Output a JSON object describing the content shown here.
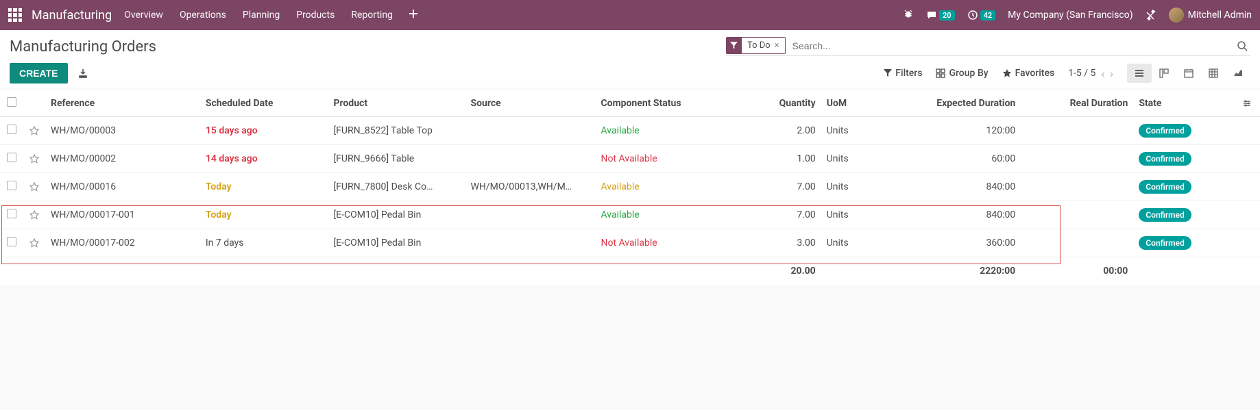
{
  "navbar": {
    "brand": "Manufacturing",
    "menu": [
      "Overview",
      "Operations",
      "Planning",
      "Products",
      "Reporting"
    ],
    "msg_badge": "20",
    "activity_badge": "42",
    "company": "My Company (San Francisco)",
    "user": "Mitchell Admin"
  },
  "header": {
    "title": "Manufacturing Orders",
    "create_label": "CREATE",
    "filter_facet": "To Do",
    "search_placeholder": "Search..."
  },
  "toolbar": {
    "filters_label": "Filters",
    "groupby_label": "Group By",
    "favorites_label": "Favorites",
    "pager_range": "1-5",
    "pager_total": "5"
  },
  "columns": {
    "reference": "Reference",
    "scheduled": "Scheduled Date",
    "product": "Product",
    "source": "Source",
    "component_status": "Component Status",
    "quantity": "Quantity",
    "uom": "UoM",
    "expected": "Expected Duration",
    "real": "Real Duration",
    "state": "State"
  },
  "rows": [
    {
      "ref": "WH/MO/00003",
      "date": "15 days ago",
      "date_cls": "overdue",
      "product": "[FURN_8522] Table Top",
      "source": "",
      "comp": "Available",
      "comp_cls": "status-available",
      "qty": "2.00",
      "uom": "Units",
      "expected": "120:00",
      "real": "",
      "state": "Confirmed"
    },
    {
      "ref": "WH/MO/00002",
      "date": "14 days ago",
      "date_cls": "overdue",
      "product": "[FURN_9666] Table",
      "source": "",
      "comp": "Not Available",
      "comp_cls": "status-notavail",
      "qty": "1.00",
      "uom": "Units",
      "expected": "60:00",
      "real": "",
      "state": "Confirmed"
    },
    {
      "ref": "WH/MO/00016",
      "date": "Today",
      "date_cls": "today",
      "product": "[FURN_7800] Desk Co…",
      "source": "WH/MO/00013,WH/M…",
      "comp": "Available",
      "comp_cls": "status-avail-warn",
      "qty": "7.00",
      "uom": "Units",
      "expected": "840:00",
      "real": "",
      "state": "Confirmed"
    },
    {
      "ref": "WH/MO/00017-001",
      "date": "Today",
      "date_cls": "today",
      "product": "[E-COM10] Pedal Bin",
      "source": "",
      "comp": "Available",
      "comp_cls": "status-available",
      "qty": "7.00",
      "uom": "Units",
      "expected": "840:00",
      "real": "",
      "state": "Confirmed"
    },
    {
      "ref": "WH/MO/00017-002",
      "date": "In 7 days",
      "date_cls": "future",
      "product": "[E-COM10] Pedal Bin",
      "source": "",
      "comp": "Not Available",
      "comp_cls": "status-notavail",
      "qty": "3.00",
      "uom": "Units",
      "expected": "360:00",
      "real": "",
      "state": "Confirmed"
    }
  ],
  "totals": {
    "qty": "20.00",
    "expected": "2220:00",
    "real": "00:00"
  }
}
